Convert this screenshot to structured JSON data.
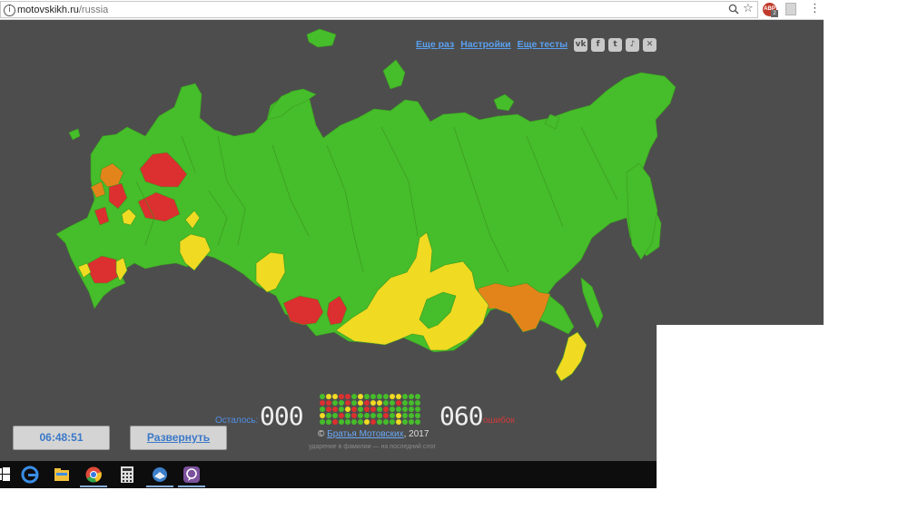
{
  "browser": {
    "url_domain": "motovskikh.ru",
    "url_path": "/russia",
    "ext_badge": "2",
    "icons": [
      "info-icon",
      "zoom-icon",
      "star-icon",
      "extension-icon",
      "menu-icon"
    ]
  },
  "header_links": {
    "again": "Еще раз",
    "settings": "Настройки",
    "more_tests": "Еще тесты"
  },
  "social": {
    "vk": "vk",
    "fb": "f",
    "tw": "t",
    "sound": "♪",
    "close": "✕"
  },
  "colors": {
    "background": "#4d4d4d",
    "correct_first_try": "#46bd2a",
    "second_try": "#f0da22",
    "third_try": "#e3841a",
    "failed": "#dc2f2f",
    "link": "#5aa0f0"
  },
  "controls": {
    "timer": "06:48:51",
    "expand": "Развернуть"
  },
  "stats": {
    "remaining_label": "Осталось:",
    "remaining_count": "000",
    "errors_count": "060",
    "errors_label": "ошибок"
  },
  "footer": {
    "copyright_symbol": "©",
    "authors": "Братья Мотовских",
    "year": ", 2017",
    "stress_note": "ударение в фамилии — на последний слог"
  },
  "taskbar": {
    "apps": [
      "windows-icon",
      "edge-icon",
      "explorer-icon",
      "chrome-icon",
      "calculator-icon",
      "thunderbird-icon",
      "viber-icon"
    ]
  }
}
